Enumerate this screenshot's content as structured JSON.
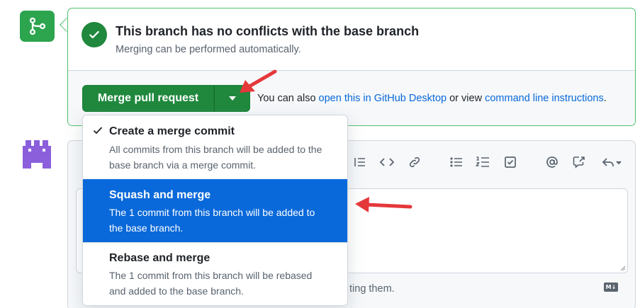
{
  "status": {
    "title": "This branch has no conflicts with the base branch",
    "subtitle": "Merging can be performed automatically."
  },
  "merge": {
    "button_label": "Merge pull request",
    "alt_prefix": "You can also ",
    "desktop_link": "open this in GitHub Desktop",
    "alt_middle": " or view ",
    "cli_link": "command line instructions",
    "alt_suffix": "."
  },
  "menu": {
    "items": [
      {
        "label": "Create a merge commit",
        "line1": "All commits from this branch will be added to the",
        "line2": "base branch via a merge commit.",
        "checked": true
      },
      {
        "label": "Squash and merge",
        "line1": "The 1 commit from this branch will be added to",
        "line2": "the base branch.",
        "highlighted": true
      },
      {
        "label": "Rebase and merge",
        "line1": "The 1 commit from this branch will be rebased",
        "line2": "and added to the base branch."
      }
    ]
  },
  "comment": {
    "attach_hint": "ting them.",
    "markdown_badge": "M↓"
  },
  "icons": {
    "branch": "git-merge-icon",
    "check": "check-circle-icon",
    "toolbar": [
      "list-indent-icon",
      "code-icon",
      "link-icon",
      "unordered-list-icon",
      "ordered-list-icon",
      "task-list-icon",
      "mention-icon",
      "cross-reference-icon",
      "reply-icon"
    ]
  },
  "colors": {
    "success": "#1f883d",
    "accent_blue": "#0969da",
    "annotation_red": "#e5383b"
  }
}
